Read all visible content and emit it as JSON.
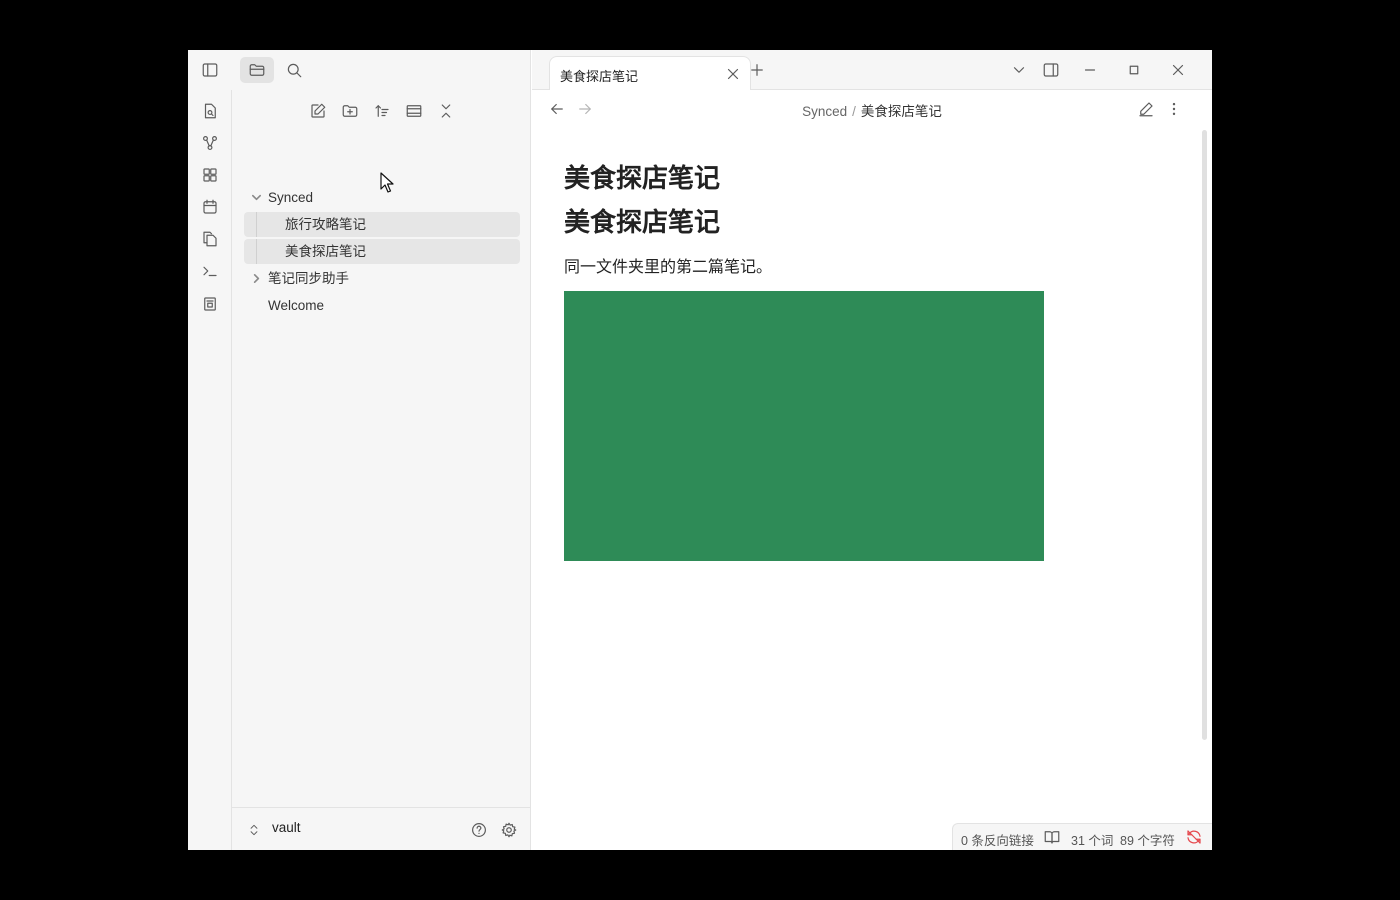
{
  "sidebar": {
    "tree": [
      {
        "label": "Synced",
        "type": "folder",
        "expanded": true
      },
      {
        "label": "旅行攻略笔记",
        "type": "file"
      },
      {
        "label": "美食探店笔记",
        "type": "file"
      },
      {
        "label": "笔记同步助手",
        "type": "folder",
        "expanded": false
      },
      {
        "label": "Welcome",
        "type": "file"
      }
    ],
    "vault": "vault"
  },
  "tabs": [
    {
      "label": "美食探店笔记",
      "active": true
    }
  ],
  "breadcrumb": {
    "folder": "Synced",
    "separator": "/",
    "current": "美食探店笔记"
  },
  "document": {
    "headings": [
      "美食探店笔记",
      "美食探店笔记"
    ],
    "paragraph": "同一文件夹里的第二篇笔记。",
    "image_color": "#2e8b57"
  },
  "status_bar": {
    "backlinks": "0 条反向链接",
    "words": "31 个词",
    "chars": "89 个字符"
  },
  "colors": {
    "accent_sync_error": "#e5484d",
    "image": "#2e8b57"
  }
}
